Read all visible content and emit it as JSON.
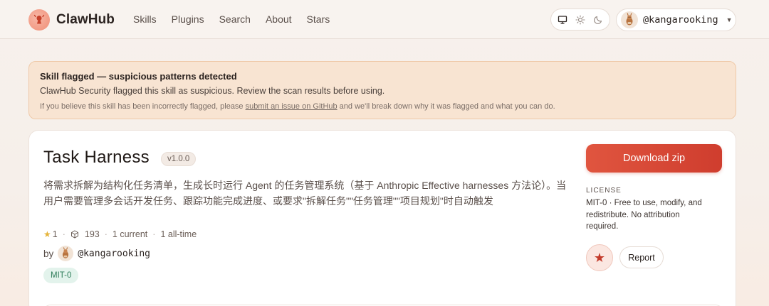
{
  "nav": {
    "brand": "ClawHub",
    "items": [
      {
        "label": "Skills"
      },
      {
        "label": "Plugins"
      },
      {
        "label": "Search"
      },
      {
        "label": "About"
      },
      {
        "label": "Stars"
      }
    ],
    "theme_icons": [
      "monitor-icon",
      "sun-icon",
      "moon-icon"
    ],
    "user": "@kangarooking"
  },
  "banner": {
    "title": "Skill flagged — suspicious patterns detected",
    "text": "ClawHub Security flagged this skill as suspicious. Review the scan results before using.",
    "note_before": "If you believe this skill has been incorrectly flagged, please ",
    "note_link": "submit an issue on GitHub",
    "note_after": " and we'll break down why it was flagged and what you can do."
  },
  "skill": {
    "title": "Task Harness",
    "version": "v1.0.0",
    "description": "将需求拆解为结构化任务清单，生成长时运行 Agent 的任务管理系统（基于 Anthropic Effective harnesses 方法论）。当用户需要管理多会话开发任务、跟踪功能完成进度、或要求\"拆解任务\"\"任务管理\"\"项目规划\"时自动触发",
    "stars": "1",
    "downloads": "193",
    "current": "1 current",
    "all_time": "1 all-time",
    "by_label": "by",
    "author": "@kangarooking",
    "license_tag": "MIT-0"
  },
  "sidebar": {
    "download_label": "Download zip",
    "license_heading": "LICENSE",
    "license_text": "MIT-0 · Free to use, modify, and redistribute. No attribution required.",
    "report_label": "Report"
  },
  "colors": {
    "accent": "#d8493a",
    "banner_bg": "#f8e4d2",
    "license_tag_bg": "#e3f3ec",
    "license_tag_fg": "#2f7d5a"
  }
}
